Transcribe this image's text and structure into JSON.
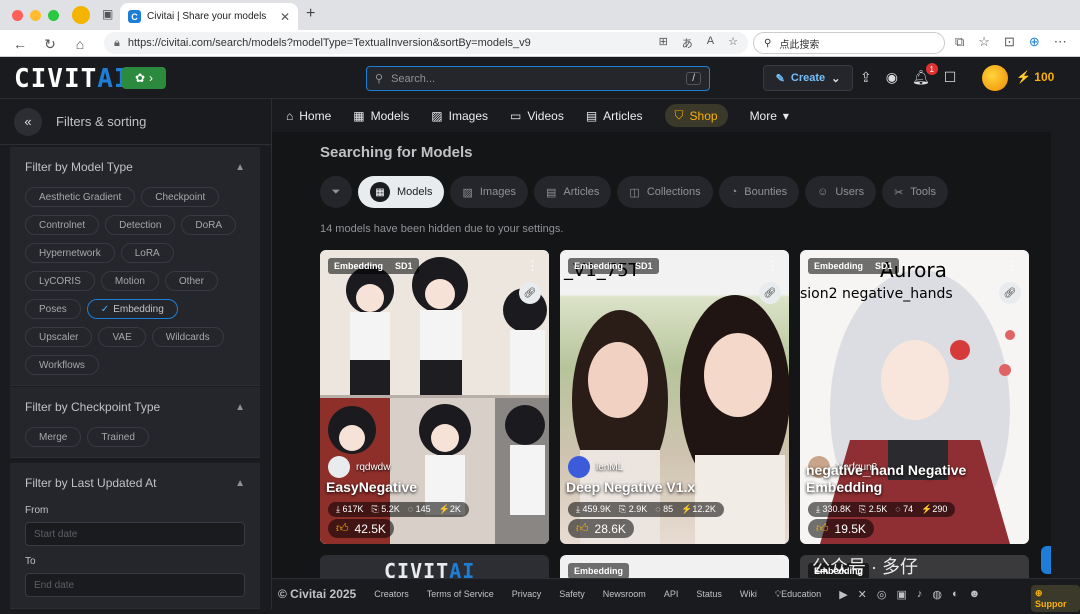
{
  "browser": {
    "tab_title": "Civitai | Share your models",
    "url": "https://civitai.com/search/models?modelType=TextualInversion&sortBy=models_v9",
    "search_placeholder": "点此搜索"
  },
  "header": {
    "logo_main": "CIVIT",
    "logo_accent": "AI",
    "search_placeholder": "Search...",
    "search_kbd": "/",
    "create_label": "Create",
    "notif_count": "1",
    "buzz": "100"
  },
  "sidebar": {
    "title": "Filters & sorting",
    "model_type": {
      "title": "Filter by Model Type",
      "chips": [
        "Aesthetic Gradient",
        "Checkpoint",
        "Controlnet",
        "Detection",
        "DoRA",
        "Hypernetwork",
        "LoRA",
        "LyCORIS",
        "Motion",
        "Other",
        "Poses",
        "Embedding",
        "Upscaler",
        "VAE",
        "Wildcards",
        "Workflows"
      ],
      "selected": "Embedding"
    },
    "checkpoint_type": {
      "title": "Filter by Checkpoint Type",
      "chips": [
        "Merge",
        "Trained"
      ]
    },
    "last_updated": {
      "title": "Filter by Last Updated At",
      "from_label": "From",
      "from_placeholder": "Start date",
      "to_label": "To",
      "to_placeholder": "End date"
    }
  },
  "nav": [
    "Home",
    "Models",
    "Images",
    "Videos",
    "Articles",
    "Shop",
    "More"
  ],
  "main": {
    "heading": "Searching for Models",
    "types": [
      "Models",
      "Images",
      "Articles",
      "Collections",
      "Bounties",
      "Users",
      "Tools"
    ],
    "hidden_note": "14 models have been hidden due to your settings.",
    "cards": [
      {
        "badge1": "Embedding",
        "badge2": "SD1",
        "creator": "rqdwdw",
        "name": "EasyNegative",
        "downloads": "617K",
        "saves": "5.2K",
        "comments": "145",
        "buzz": "2K",
        "likes": "42.5K",
        "overlay": ""
      },
      {
        "badge1": "Embedding",
        "badge2": "SD1",
        "creator": "lenML",
        "name": "Deep Negative V1.x",
        "downloads": "459.9K",
        "saves": "2.9K",
        "comments": "85",
        "buzz": "12.2K",
        "likes": "28.6K",
        "overlay": "_V1_75T"
      },
      {
        "badge1": "Embedding",
        "badge2": "SD1",
        "creator": "Nerfgun3",
        "name": "negative_hand Negative Embedding",
        "downloads": "330.8K",
        "saves": "2.5K",
        "comments": "74",
        "buzz": "290",
        "likes": "19.5K",
        "overlay": "Aurora"
      }
    ],
    "card3_overlay2": "sion2     negative_hands",
    "row2_badge": "Embedding"
  },
  "footer": {
    "copy": "© Civitai 2025",
    "links": [
      "Creators",
      "Terms of Service",
      "Privacy",
      "Safety",
      "Newsroom",
      "API",
      "Status",
      "Wiki",
      "Education"
    ],
    "support": "Suppor"
  },
  "watermark": "公众号 · 多仔",
  "colors": {
    "accent": "#1c7ed6",
    "buzz": "#fab005",
    "bg": "#1a1b1e"
  }
}
